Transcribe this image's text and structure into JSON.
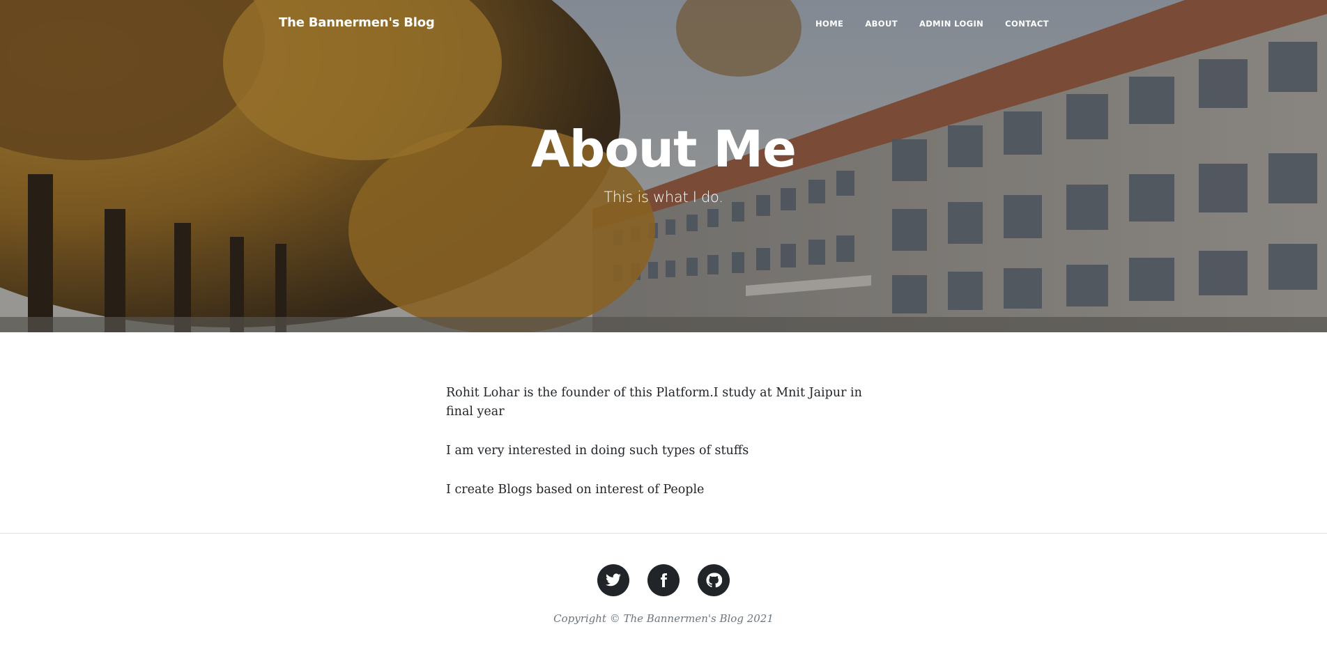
{
  "navbar": {
    "brand": "The Bannermen's Blog",
    "links": [
      "HOME",
      "ABOUT",
      "ADMIN LOGIN",
      "CONTACT"
    ]
  },
  "hero": {
    "heading": "About Me",
    "subheading": "This is what I do."
  },
  "content": {
    "paragraphs": [
      "Rohit Lohar is the founder of this Platform.I study at Mnit Jaipur in final year",
      "I am very interested in doing such types of stuffs",
      "I create Blogs based on interest of People"
    ]
  },
  "footer": {
    "social_icons": [
      "twitter-icon",
      "facebook-icon",
      "github-icon"
    ],
    "copyright": "Copyright © The Bannermen's Blog 2021"
  },
  "colors": {
    "dark": "#212529",
    "muted": "#6c757d",
    "rule": "#dee2e6"
  }
}
